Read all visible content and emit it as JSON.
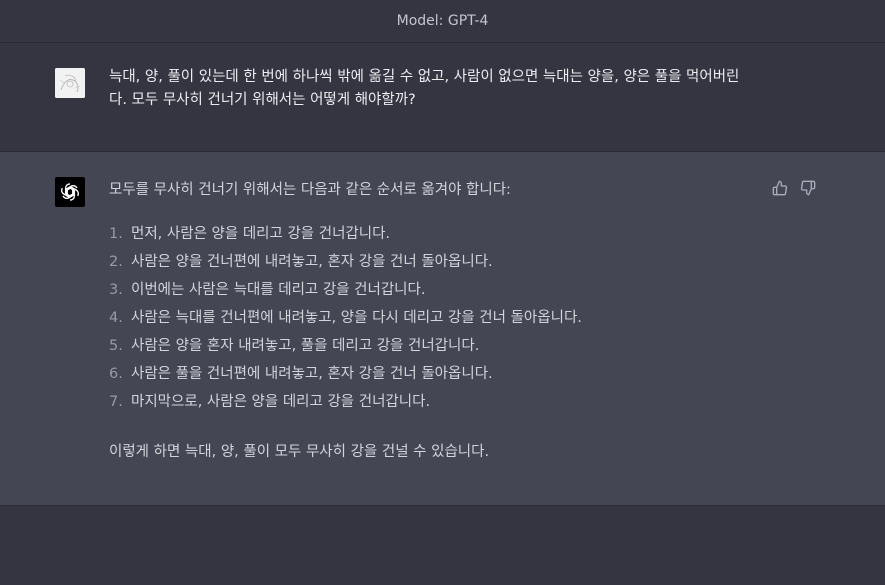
{
  "header": {
    "model_label": "Model: GPT-4"
  },
  "user_message": {
    "line1": "늑대, 양, 풀이 있는데 한 번에 하나씩 밖에 옮길 수 없고, 사람이 없으면 늑대는 양을, 양은 풀을 먹어버린",
    "line2": "다. 모두 무사히 건너기 위해서는 어떻게 해야할까?"
  },
  "assistant_message": {
    "intro": "모두를 무사히 건너기 위해서는 다음과 같은 순서로 옮겨야 합니다:",
    "steps": [
      {
        "num": "1.",
        "text": "먼저, 사람은 양을 데리고 강을 건너갑니다."
      },
      {
        "num": "2.",
        "text": "사람은 양을 건너편에 내려놓고, 혼자 강을 건너 돌아옵니다."
      },
      {
        "num": "3.",
        "text": "이번에는 사람은 늑대를 데리고 강을 건너갑니다."
      },
      {
        "num": "4.",
        "text": "사람은 늑대를 건너편에 내려놓고, 양을 다시 데리고 강을 건너 돌아옵니다."
      },
      {
        "num": "5.",
        "text": "사람은 양을 혼자 내려놓고, 풀을 데리고 강을 건너갑니다."
      },
      {
        "num": "6.",
        "text": "사람은 풀을 건너편에 내려놓고, 혼자 강을 건너 돌아옵니다."
      },
      {
        "num": "7.",
        "text": "마지막으로, 사람은 양을 데리고 강을 건너갑니다."
      }
    ],
    "outro": "이렇게 하면 늑대, 양, 풀이 모두 무사히 강을 건널 수 있습니다."
  },
  "icons": {
    "user_avatar": "user-avatar-image",
    "assistant_avatar": "openai-logo-icon",
    "thumbs_up": "thumbs-up-icon",
    "thumbs_down": "thumbs-down-icon"
  },
  "colors": {
    "background": "#343541",
    "assistant_background": "#444654",
    "text": "#ececf1",
    "muted_text": "#c5c5d2"
  }
}
